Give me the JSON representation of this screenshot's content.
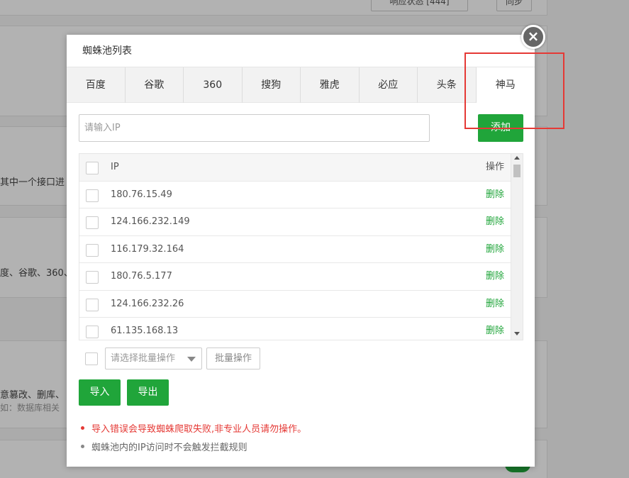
{
  "background": {
    "top_button_1": "响应状态 [444]",
    "top_button_2": "同步",
    "text_1": "其中一个接口进",
    "text_2": "度、谷歌、360、",
    "text_3": "意篡改、删库、",
    "text_4": "如：数据库相关"
  },
  "dialog": {
    "title": "蜘蛛池列表",
    "close_icon": "close-icon",
    "tabs": [
      {
        "label": "百度"
      },
      {
        "label": "谷歌"
      },
      {
        "label": "360"
      },
      {
        "label": "搜狗"
      },
      {
        "label": "雅虎"
      },
      {
        "label": "必应"
      },
      {
        "label": "头条"
      },
      {
        "label": "神马",
        "active": true
      }
    ],
    "ip_input": {
      "placeholder": "请输入IP",
      "value": ""
    },
    "add_label": "添加",
    "table": {
      "col_ip": "IP",
      "col_op": "操作",
      "rows": [
        {
          "ip": "180.76.15.49",
          "op": "删除"
        },
        {
          "ip": "124.166.232.149",
          "op": "删除"
        },
        {
          "ip": "116.179.32.164",
          "op": "删除"
        },
        {
          "ip": "180.76.5.177",
          "op": "删除"
        },
        {
          "ip": "124.166.232.26",
          "op": "删除"
        },
        {
          "ip": "61.135.168.13",
          "op": "删除"
        }
      ]
    },
    "batch": {
      "select_placeholder": "请选择批量操作",
      "button_label": "批量操作"
    },
    "import_label": "导入",
    "export_label": "导出",
    "notes": {
      "warning": "导入错误会导致蜘蛛爬取失败,非专业人员请勿操作。",
      "info": "蜘蛛池内的IP访问时不会触发拦截规则"
    }
  },
  "colors": {
    "accent": "#20a53a",
    "warning": "#e53935",
    "annotation": "#e53935"
  }
}
